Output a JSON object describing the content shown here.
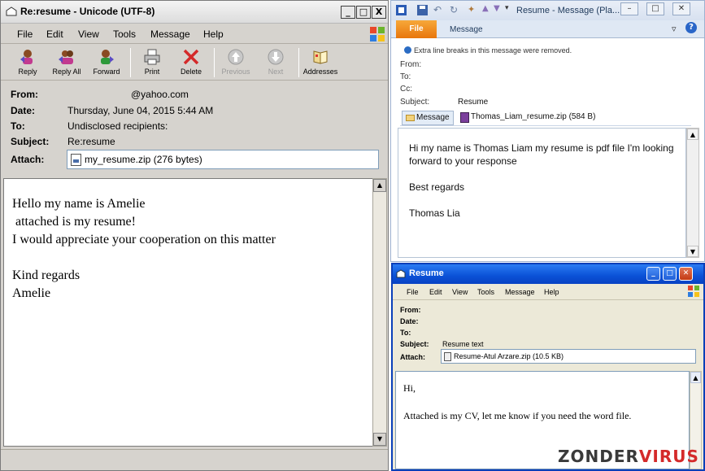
{
  "left_window": {
    "title": "Re:resume - Unicode (UTF-8)",
    "controls": [
      "_",
      "□",
      "X"
    ],
    "menu": [
      "File",
      "Edit",
      "View",
      "Tools",
      "Message",
      "Help"
    ],
    "toolbar": {
      "reply": "Reply",
      "reply_all": "Reply All",
      "forward": "Forward",
      "print": "Print",
      "delete": "Delete",
      "previous": "Previous",
      "next": "Next",
      "addresses": "Addresses"
    },
    "headers": {
      "from_label": "From:",
      "from_value": "@yahoo.com",
      "date_label": "Date:",
      "date_value": "Thursday, June 04, 2015 5:44 AM",
      "to_label": "To:",
      "to_value": "Undisclosed recipients:",
      "subject_label": "Subject:",
      "subject_value": "Re:resume",
      "attach_label": "Attach:",
      "attach_value": "my_resume.zip (276 bytes)"
    },
    "body": "Hello my name is Amelie\n attached is my resume!\nI would appreciate your cooperation on this matter\n\nKind regards\nAmelie"
  },
  "top_right_window": {
    "title": "Resume - Message (Pla...",
    "tabs": {
      "file": "File",
      "message": "Message"
    },
    "info_bar": "Extra line breaks in this message were removed.",
    "headers": {
      "from_label": "From:",
      "to_label": "To:",
      "cc_label": "Cc:",
      "subject_label": "Subject:",
      "subject_value": "Resume"
    },
    "attachment_tabs": {
      "message": "Message",
      "zip": "Thomas_Liam_resume.zip (584 B)"
    },
    "body_line1": "Hi my name is Thomas Liam my resume is pdf file I'm looking forward to your response",
    "body_line2": "Best regards",
    "body_line3": "Thomas Lia"
  },
  "bottom_right_window": {
    "title": "Resume",
    "menu": [
      "File",
      "Edit",
      "View",
      "Tools",
      "Message",
      "Help"
    ],
    "headers": {
      "from_label": "From:",
      "date_label": "Date:",
      "to_label": "To:",
      "subject_label": "Subject:",
      "subject_value": "Resume text",
      "attach_label": "Attach:",
      "attach_value": "Resume-Atul Arzare.zip (10.5 KB)"
    },
    "body": "Hi,\n\nAttached is my CV, let me know if you need the word file."
  },
  "watermark": {
    "part1": "ZONDER",
    "part2": "VIRUS"
  },
  "colors": {
    "xp_title_blue": "#0a51d6",
    "file_tab_orange": "#e8760c",
    "delete_red": "#d42a2a"
  }
}
